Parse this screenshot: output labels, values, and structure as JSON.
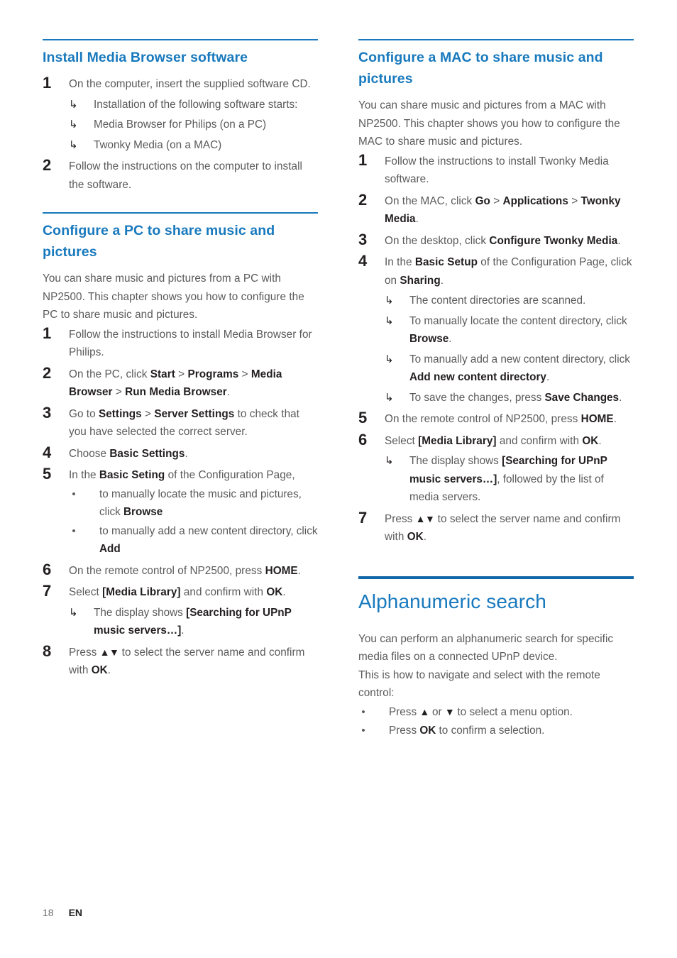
{
  "colors": {
    "heading_blue": "#1879bd",
    "chapter_rule": "#1267a8",
    "body_gray": "#5a5a5c",
    "bold_black": "#231f20"
  },
  "glyphs": {
    "arrow_sub": "↳",
    "bullet": "•",
    "up_down": "▲▼",
    "up": "▲",
    "down": "▼"
  },
  "footer": {
    "page_number": "18",
    "language": "EN"
  },
  "left_column": {
    "section1": {
      "title": "Install Media Browser software",
      "steps": [
        {
          "number": "1",
          "text_parts": [
            {
              "t": "On the computer, insert the supplied software CD.",
              "b": false
            }
          ],
          "subs": [
            {
              "kind": "arrow",
              "parts": [
                {
                  "t": "Installation of the following software starts:",
                  "b": false
                }
              ]
            },
            {
              "kind": "arrow",
              "parts": [
                {
                  "t": "Media Browser for Philips (on a PC)",
                  "b": false
                }
              ]
            },
            {
              "kind": "arrow",
              "parts": [
                {
                  "t": "Twonky Media (on a MAC)",
                  "b": false
                }
              ]
            }
          ]
        },
        {
          "number": "2",
          "text_parts": [
            {
              "t": "Follow the instructions on the computer to install the software.",
              "b": false
            }
          ],
          "subs": []
        }
      ]
    },
    "section2": {
      "title": "Configure a PC to share music and pictures",
      "intro": "You can share music and pictures from a PC with NP2500. This chapter shows you how to configure the PC to share music and pictures.",
      "steps": [
        {
          "number": "1",
          "text_parts": [
            {
              "t": "Follow the instructions to install Media Browser for Philips.",
              "b": false
            }
          ],
          "subs": []
        },
        {
          "number": "2",
          "text_parts": [
            {
              "t": "On the PC, click ",
              "b": false
            },
            {
              "t": "Start",
              "b": true
            },
            {
              "t": " > ",
              "b": false
            },
            {
              "t": "Programs",
              "b": true
            },
            {
              "t": " > ",
              "b": false
            },
            {
              "t": "Media Browser",
              "b": true
            },
            {
              "t": " > ",
              "b": false
            },
            {
              "t": "Run Media Browser",
              "b": true
            },
            {
              "t": ".",
              "b": false
            }
          ],
          "subs": []
        },
        {
          "number": "3",
          "text_parts": [
            {
              "t": "Go to ",
              "b": false
            },
            {
              "t": "Settings",
              "b": true
            },
            {
              "t": " > ",
              "b": false
            },
            {
              "t": "Server Settings",
              "b": true
            },
            {
              "t": " to check that you have selected the correct server.",
              "b": false
            }
          ],
          "subs": []
        },
        {
          "number": "4",
          "text_parts": [
            {
              "t": "Choose ",
              "b": false
            },
            {
              "t": "Basic Settings",
              "b": true
            },
            {
              "t": ".",
              "b": false
            }
          ],
          "subs": []
        },
        {
          "number": "5",
          "text_parts": [
            {
              "t": "In the ",
              "b": false
            },
            {
              "t": "Basic Seting",
              "b": true
            },
            {
              "t": " of the Configuration Page,",
              "b": false
            }
          ],
          "subs": [
            {
              "kind": "bullet",
              "parts": [
                {
                  "t": "to manually locate the music and pictures, click ",
                  "b": false
                },
                {
                  "t": "Browse",
                  "b": true
                }
              ]
            },
            {
              "kind": "bullet",
              "parts": [
                {
                  "t": "to manually add a new content directory, click ",
                  "b": false
                },
                {
                  "t": "Add",
                  "b": true
                }
              ]
            }
          ]
        },
        {
          "number": "6",
          "text_parts": [
            {
              "t": "On the remote control of NP2500, press ",
              "b": false
            },
            {
              "t": "HOME",
              "b": true
            },
            {
              "t": ".",
              "b": false
            }
          ],
          "subs": []
        },
        {
          "number": "7",
          "text_parts": [
            {
              "t": "Select ",
              "b": false
            },
            {
              "t": "[Media Library]",
              "b": true
            },
            {
              "t": " and confirm with ",
              "b": false
            },
            {
              "t": "OK",
              "b": true
            },
            {
              "t": ".",
              "b": false
            }
          ],
          "subs": [
            {
              "kind": "arrow",
              "parts": [
                {
                  "t": "The display shows ",
                  "b": false
                },
                {
                  "t": "[Searching for UPnP music servers…]",
                  "b": true
                },
                {
                  "t": ".",
                  "b": false
                }
              ]
            }
          ]
        },
        {
          "number": "8",
          "text_parts": [
            {
              "t": "Press ",
              "b": false
            },
            {
              "t": "▲▼",
              "b": false,
              "arrows": true
            },
            {
              "t": " to select the server name and confirm with ",
              "b": false
            },
            {
              "t": "OK",
              "b": true
            },
            {
              "t": ".",
              "b": false
            }
          ],
          "subs": []
        }
      ]
    }
  },
  "right_column": {
    "section1": {
      "title": "Configure a MAC to share music and pictures",
      "intro": "You can share music and pictures from a MAC with NP2500. This chapter shows you how to configure the MAC to share music and pictures.",
      "steps": [
        {
          "number": "1",
          "text_parts": [
            {
              "t": "Follow the instructions to install Twonky Media software.",
              "b": false
            }
          ],
          "subs": []
        },
        {
          "number": "2",
          "text_parts": [
            {
              "t": "On the MAC, click ",
              "b": false
            },
            {
              "t": "Go",
              "b": true
            },
            {
              "t": " > ",
              "b": false
            },
            {
              "t": "Applications",
              "b": true
            },
            {
              "t": " > ",
              "b": false
            },
            {
              "t": "Twonky Media",
              "b": true
            },
            {
              "t": ".",
              "b": false
            }
          ],
          "subs": []
        },
        {
          "number": "3",
          "text_parts": [
            {
              "t": "On the desktop, click ",
              "b": false
            },
            {
              "t": "Configure Twonky Media",
              "b": true
            },
            {
              "t": ".",
              "b": false
            }
          ],
          "subs": []
        },
        {
          "number": "4",
          "text_parts": [
            {
              "t": "In the ",
              "b": false
            },
            {
              "t": "Basic Setup",
              "b": true
            },
            {
              "t": " of the Configuration Page, click on ",
              "b": false
            },
            {
              "t": "Sharing",
              "b": true
            },
            {
              "t": ".",
              "b": false
            }
          ],
          "subs": [
            {
              "kind": "arrow",
              "parts": [
                {
                  "t": "The content directories are scanned.",
                  "b": false
                }
              ]
            },
            {
              "kind": "arrow",
              "parts": [
                {
                  "t": "To manually locate the content directory, click ",
                  "b": false
                },
                {
                  "t": "Browse",
                  "b": true
                },
                {
                  "t": ".",
                  "b": false
                }
              ]
            },
            {
              "kind": "arrow",
              "parts": [
                {
                  "t": "To manually add a new content directory, click ",
                  "b": false
                },
                {
                  "t": "Add new content directory",
                  "b": true
                },
                {
                  "t": ".",
                  "b": false
                }
              ]
            },
            {
              "kind": "arrow",
              "parts": [
                {
                  "t": "To save the changes, press ",
                  "b": false
                },
                {
                  "t": "Save Changes",
                  "b": true
                },
                {
                  "t": ".",
                  "b": false
                }
              ]
            }
          ]
        },
        {
          "number": "5",
          "text_parts": [
            {
              "t": "On the remote control of NP2500, press ",
              "b": false
            },
            {
              "t": "HOME",
              "b": true
            },
            {
              "t": ".",
              "b": false
            }
          ],
          "subs": []
        },
        {
          "number": "6",
          "text_parts": [
            {
              "t": "Select ",
              "b": false
            },
            {
              "t": "[Media Library]",
              "b": true
            },
            {
              "t": " and confirm with ",
              "b": false
            },
            {
              "t": "OK",
              "b": true
            },
            {
              "t": ".",
              "b": false
            }
          ],
          "subs": [
            {
              "kind": "arrow",
              "parts": [
                {
                  "t": "The display shows ",
                  "b": false
                },
                {
                  "t": "[Searching for UPnP music servers…]",
                  "b": true
                },
                {
                  "t": ", followed by the list of media servers.",
                  "b": false
                }
              ]
            }
          ]
        },
        {
          "number": "7",
          "text_parts": [
            {
              "t": "Press ",
              "b": false
            },
            {
              "t": "▲▼",
              "b": false,
              "arrows": true
            },
            {
              "t": " to select the server name and confirm with ",
              "b": false
            },
            {
              "t": "OK",
              "b": true
            },
            {
              "t": ".",
              "b": false
            }
          ],
          "subs": []
        }
      ]
    },
    "chapter": {
      "title": "Alphanumeric search",
      "paragraphs": [
        "You can perform an alphanumeric search for specific media files on a connected UPnP device.",
        "This is how to navigate and select with the remote control:"
      ],
      "bullets": [
        {
          "parts": [
            {
              "t": "Press ",
              "b": false
            },
            {
              "t": "▲",
              "b": false,
              "arrows": true
            },
            {
              "t": " or ",
              "b": false
            },
            {
              "t": "▼",
              "b": false,
              "arrows": true
            },
            {
              "t": " to select a menu option.",
              "b": false
            }
          ]
        },
        {
          "parts": [
            {
              "t": "Press ",
              "b": false
            },
            {
              "t": "OK",
              "b": true
            },
            {
              "t": " to confirm a selection.",
              "b": false
            }
          ]
        }
      ]
    }
  }
}
